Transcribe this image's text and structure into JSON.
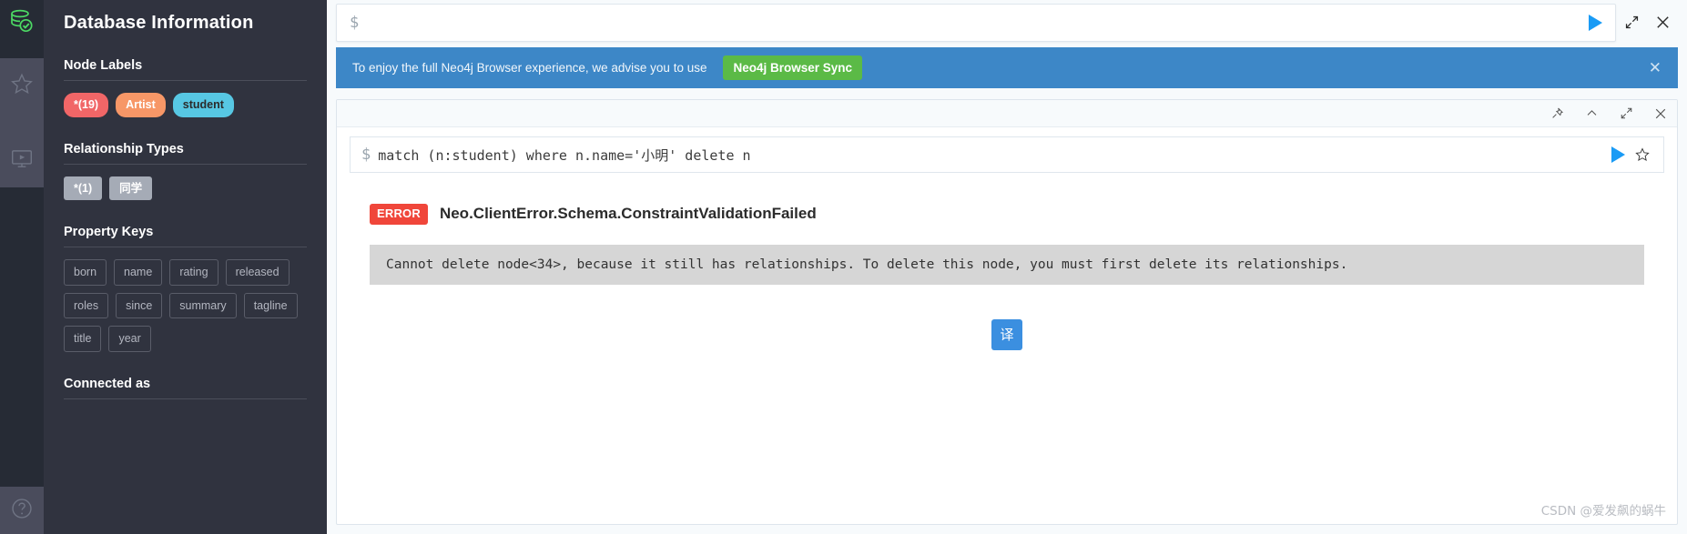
{
  "rail": {
    "logo_icon": "neo4j-database-check-logo",
    "items": [
      {
        "icon": "star-favorites-icon",
        "name": "favorites"
      },
      {
        "icon": "play-guide-monitor-icon",
        "name": "guides"
      }
    ],
    "help_icon": "help-question-icon"
  },
  "sidebar": {
    "title": "Database Information",
    "sections": [
      {
        "title": "Node Labels",
        "chips": [
          {
            "label": "*(19)",
            "bg": "#f16667",
            "fg": "#ffffff"
          },
          {
            "label": "Artist",
            "bg": "#f79767",
            "fg": "#ffffff"
          },
          {
            "label": "student",
            "bg": "#57c7e3",
            "fg": "#2b2b2b"
          }
        ]
      },
      {
        "title": "Relationship Types",
        "chips": [
          {
            "label": "*(1)",
            "bg": "#a5abb6",
            "fg": "#ffffff"
          },
          {
            "label": "同学",
            "bg": "#a5abb6",
            "fg": "#ffffff"
          }
        ]
      },
      {
        "title": "Property Keys",
        "chips": [
          {
            "label": "born"
          },
          {
            "label": "name"
          },
          {
            "label": "rating"
          },
          {
            "label": "released"
          },
          {
            "label": "roles"
          },
          {
            "label": "since"
          },
          {
            "label": "summary"
          },
          {
            "label": "tagline"
          },
          {
            "label": "title"
          },
          {
            "label": "year"
          }
        ]
      },
      {
        "title": "Connected as",
        "chips": []
      }
    ]
  },
  "editor": {
    "prompt": "$",
    "value": "",
    "placeholder": "",
    "run_icon": "play-run-icon",
    "expand_icon": "expand-fullscreen-icon",
    "close_icon": "close-x-icon"
  },
  "banner": {
    "text": "To enjoy the full Neo4j Browser experience, we advise you to use",
    "button_label": "Neo4j Browser Sync",
    "button_color": "#5bba46",
    "background": "#3d87c7",
    "close_icon": "close-x-icon"
  },
  "frame": {
    "head_icons": [
      {
        "icon": "pin-icon",
        "name": "pin-frame"
      },
      {
        "icon": "chevron-up-icon",
        "name": "collapse-frame"
      },
      {
        "icon": "expand-fullscreen-icon",
        "name": "expand-frame"
      },
      {
        "icon": "close-x-icon",
        "name": "close-frame"
      }
    ],
    "query": {
      "prompt": "$",
      "text": "match (n:student) where n.name='小明' delete n",
      "run_icon": "play-run-icon",
      "favorite_icon": "star-favorite-icon"
    },
    "error": {
      "badge": "ERROR",
      "badge_color": "#f0463a",
      "title": "Neo.ClientError.Schema.ConstraintValidationFailed",
      "message": "Cannot delete node<34>, because it still has relationships. To delete this node, you must first delete its relationships."
    },
    "translate_button": {
      "label": "译",
      "color": "#3b8fe0"
    }
  },
  "watermark": "CSDN @爱发飙的蜗牛"
}
